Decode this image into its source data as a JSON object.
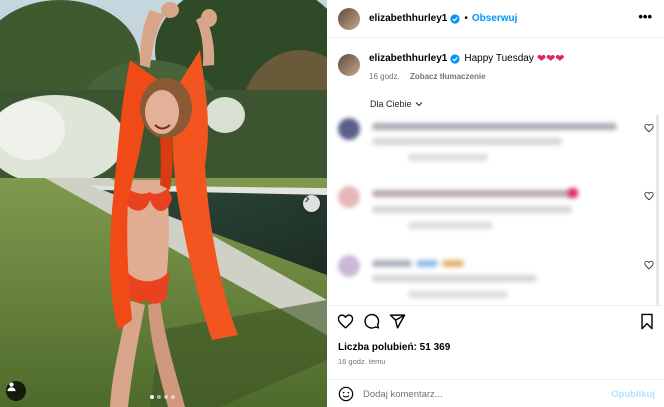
{
  "post": {
    "username": "elizabethhurley1",
    "follow_label": "Obserwuj",
    "more_label": "•••",
    "caption_text": "Happy Tuesday",
    "caption_hearts": "❤❤❤",
    "caption_time": "16 godz.",
    "translate_label": "Zobacz tłumaczenie",
    "filter_label": "Dla Ciebie",
    "likes_text": "Liczba polubień: 51 369",
    "time_text": "16 godz. temu",
    "comment_placeholder": "Dodaj komentarz...",
    "post_button": "Opublikuj"
  },
  "carousel": {
    "total": 4,
    "active_index": 0
  },
  "icons": [
    "verified-badge-icon",
    "more-options-icon",
    "like-icon",
    "comment-icon",
    "share-icon",
    "save-icon",
    "emoji-icon",
    "next-arrow-icon",
    "tag-people-icon",
    "chevron-down-icon"
  ],
  "colors": {
    "link_blue": "#0095f6",
    "heart_red": "#e0245e",
    "muted": "#737373",
    "post_disabled": "#b2dffc"
  }
}
